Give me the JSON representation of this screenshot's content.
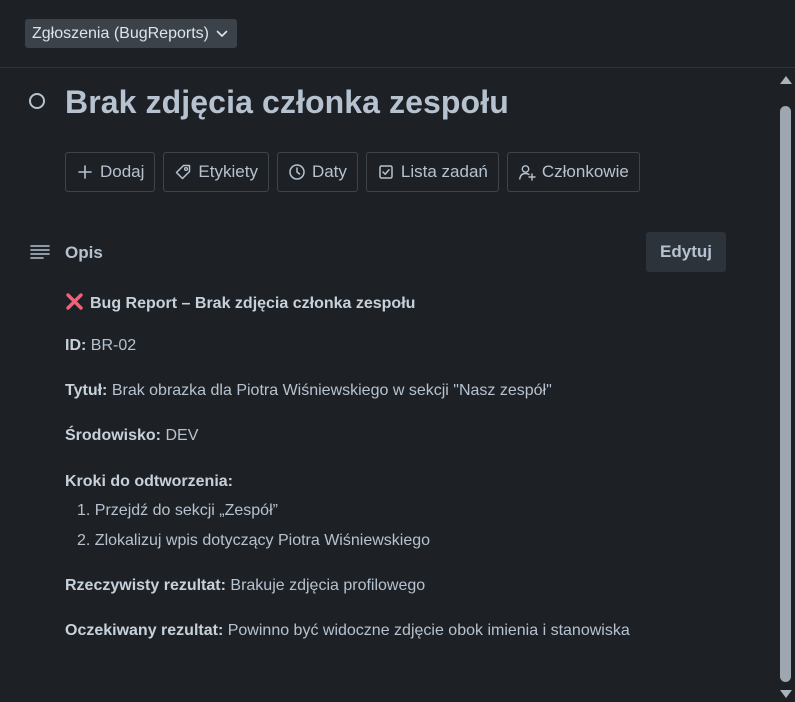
{
  "header": {
    "list_name": "Zgłoszenia (BugReports)"
  },
  "card": {
    "title": "Brak zdjęcia członka zespołu"
  },
  "actions": [
    {
      "label": "Dodaj",
      "icon": "plus-icon"
    },
    {
      "label": "Etykiety",
      "icon": "tag-icon"
    },
    {
      "label": "Daty",
      "icon": "clock-icon"
    },
    {
      "label": "Lista zadań",
      "icon": "checklist-icon"
    },
    {
      "label": "Członkowie",
      "icon": "add-member-icon"
    }
  ],
  "description": {
    "label": "Opis",
    "edit_label": "Edytuj",
    "heading": "Bug Report – Brak zdjęcia członka zespołu",
    "id_label": "ID:",
    "id_value": "BR-02",
    "title_label": "Tytuł:",
    "title_value": "Brak obrazka dla Piotra Wiśniewskiego w sekcji \"Nasz zespół\"",
    "env_label": "Środowisko:",
    "env_value": "DEV",
    "steps_label": "Kroki do odtworzenia:",
    "steps": [
      "1. Przejdź do sekcji „Zespół”",
      "2. Zlokalizuj wpis dotyczący Piotra Wiśniewskiego"
    ],
    "actual_label": "Rzeczywisty rezultat:",
    "actual_value": "Brakuje zdjęcia profilowego",
    "expected_label": "Oczekiwany rezultat:",
    "expected_value": "Powinno być widoczne zdjęcie obok imienia i stanowiska"
  },
  "colors": {
    "background": "#1d2125",
    "text": "#b6c2cf",
    "x_mark": "#f75e77",
    "chip_bg": "#3b4249"
  }
}
